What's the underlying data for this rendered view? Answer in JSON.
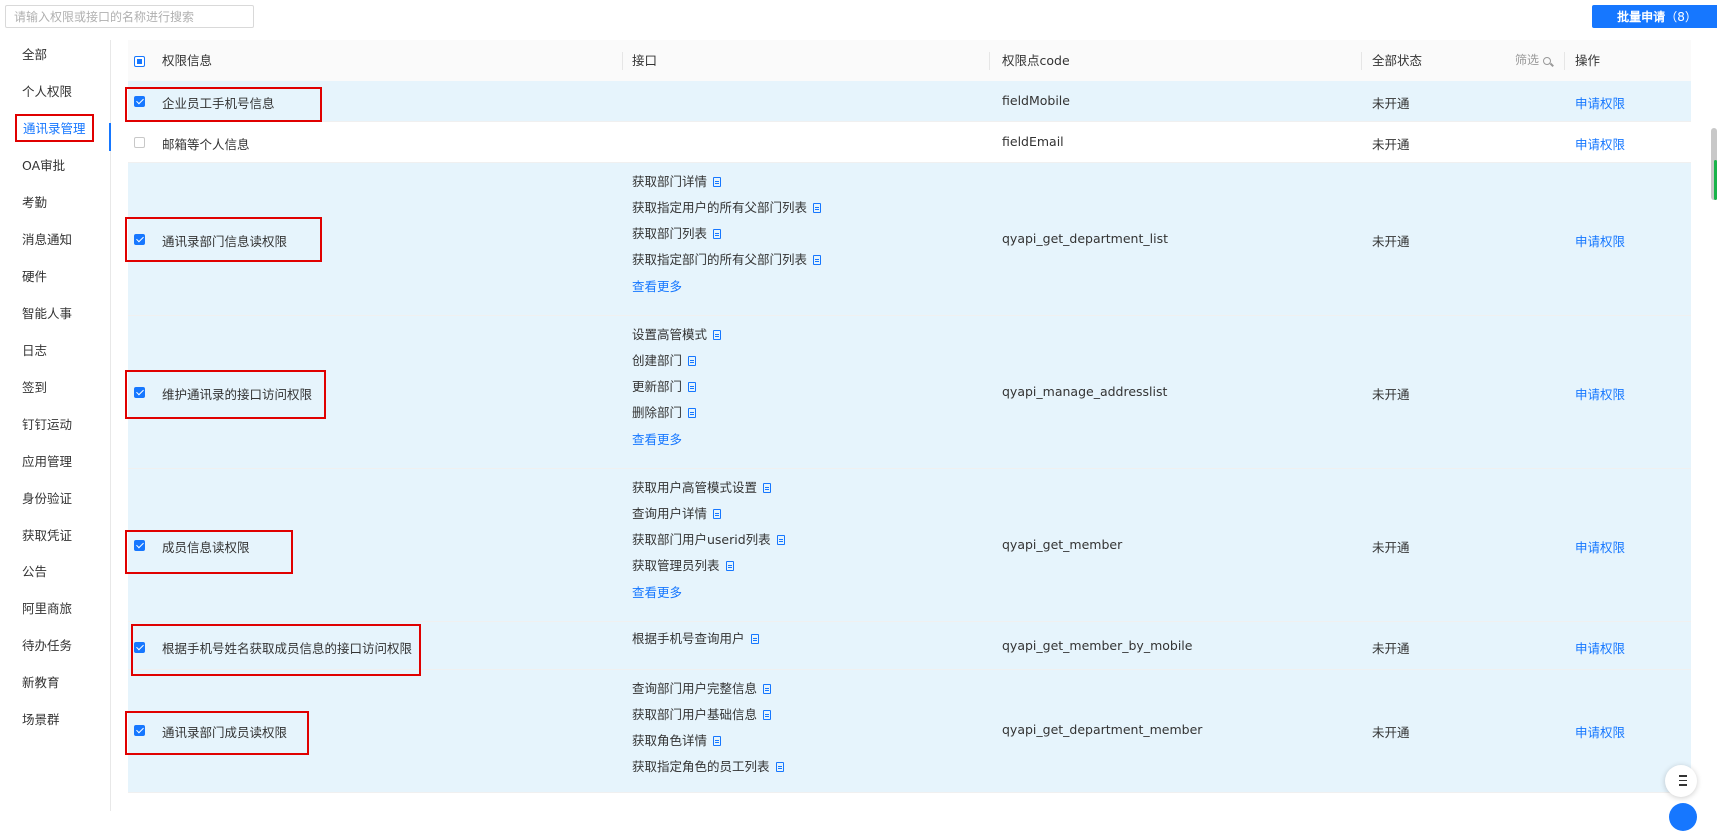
{
  "search": {
    "placeholder": "请输入权限或接口的名称进行搜索"
  },
  "batch_button": {
    "label": "批量申请",
    "count": "（8）"
  },
  "sidebar": {
    "items": [
      {
        "label": "全部"
      },
      {
        "label": "个人权限"
      },
      {
        "label": "通讯录管理",
        "active": true
      },
      {
        "label": "OA审批"
      },
      {
        "label": "考勤"
      },
      {
        "label": "消息通知"
      },
      {
        "label": "硬件"
      },
      {
        "label": "智能人事"
      },
      {
        "label": "日志"
      },
      {
        "label": "签到"
      },
      {
        "label": "钉钉运动"
      },
      {
        "label": "应用管理"
      },
      {
        "label": "身份验证"
      },
      {
        "label": "获取凭证"
      },
      {
        "label": "公告"
      },
      {
        "label": "阿里商旅"
      },
      {
        "label": "待办任务"
      },
      {
        "label": "新教育"
      },
      {
        "label": "场景群"
      }
    ]
  },
  "table": {
    "headers": {
      "info": "权限信息",
      "api": "接口",
      "code": "权限点code",
      "status": "全部状态",
      "filter": "筛选",
      "action": "操作"
    },
    "rows": [
      {
        "name": "企业员工手机号信息",
        "checked": true,
        "apis": [],
        "more": "",
        "code": "fieldMobile",
        "status": "未开通",
        "action": "申请权限"
      },
      {
        "name": "邮箱等个人信息",
        "checked": false,
        "apis": [],
        "more": "",
        "code": "fieldEmail",
        "status": "未开通",
        "action": "申请权限"
      },
      {
        "name": "通讯录部门信息读权限",
        "checked": true,
        "apis": [
          "获取部门详情",
          "获取指定用户的所有父部门列表",
          "获取部门列表",
          "获取指定部门的所有父部门列表"
        ],
        "more": "查看更多",
        "code": "qyapi_get_department_list",
        "status": "未开通",
        "action": "申请权限"
      },
      {
        "name": "维护通讯录的接口访问权限",
        "checked": true,
        "apis": [
          "设置高管模式",
          "创建部门",
          "更新部门",
          "删除部门"
        ],
        "more": "查看更多",
        "code": "qyapi_manage_addresslist",
        "status": "未开通",
        "action": "申请权限"
      },
      {
        "name": "成员信息读权限",
        "checked": true,
        "apis": [
          "获取用户高管模式设置",
          "查询用户详情",
          "获取部门用户userid列表",
          "获取管理员列表"
        ],
        "more": "查看更多",
        "code": "qyapi_get_member",
        "status": "未开通",
        "action": "申请权限"
      },
      {
        "name": "根据手机号姓名获取成员信息的接口访问权限",
        "checked": true,
        "apis": [
          "根据手机号查询用户"
        ],
        "more": "",
        "code": "qyapi_get_member_by_mobile",
        "status": "未开通",
        "action": "申请权限"
      },
      {
        "name": "通讯录部门成员读权限",
        "checked": true,
        "apis": [
          "查询部门用户完整信息",
          "获取部门用户基础信息",
          "获取角色详情",
          "获取指定角色的员工列表"
        ],
        "more": "",
        "code": "qyapi_get_department_member",
        "status": "未开通",
        "action": "申请权限"
      }
    ]
  },
  "icons": {
    "doc": "doc-link-icon",
    "filter": "search-icon",
    "float": "list-icon"
  },
  "colors": {
    "accent": "#1677ff",
    "selected_row": "#e6f4fc",
    "highlight": "#e00000"
  }
}
